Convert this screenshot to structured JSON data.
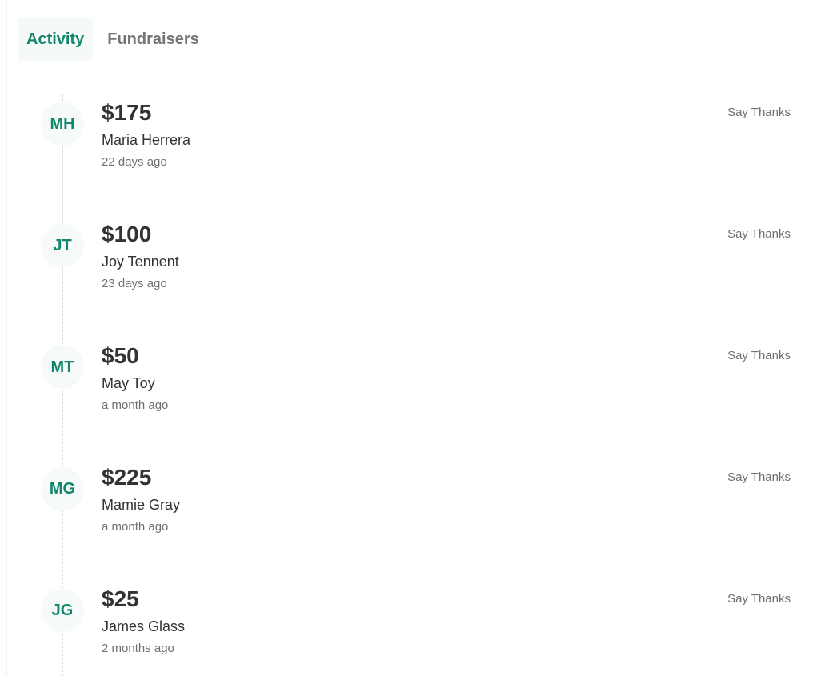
{
  "tabs": [
    {
      "label": "Activity",
      "active": true
    },
    {
      "label": "Fundraisers",
      "active": false
    }
  ],
  "colors": {
    "accent": "#12866d",
    "avatar_bg": "#f6faf9",
    "muted": "#6f6f6f"
  },
  "activity": [
    {
      "initials": "MH",
      "amount": "$175",
      "name": "Maria Herrera",
      "time": "22 days ago",
      "action": "Say Thanks"
    },
    {
      "initials": "JT",
      "amount": "$100",
      "name": "Joy Tennent",
      "time": "23 days ago",
      "action": "Say Thanks"
    },
    {
      "initials": "MT",
      "amount": "$50",
      "name": "May Toy",
      "time": "a month ago",
      "action": "Say Thanks"
    },
    {
      "initials": "MG",
      "amount": "$225",
      "name": "Mamie Gray",
      "time": "a month ago",
      "action": "Say Thanks"
    },
    {
      "initials": "JG",
      "amount": "$25",
      "name": "James Glass",
      "time": "2 months ago",
      "action": "Say Thanks"
    }
  ]
}
